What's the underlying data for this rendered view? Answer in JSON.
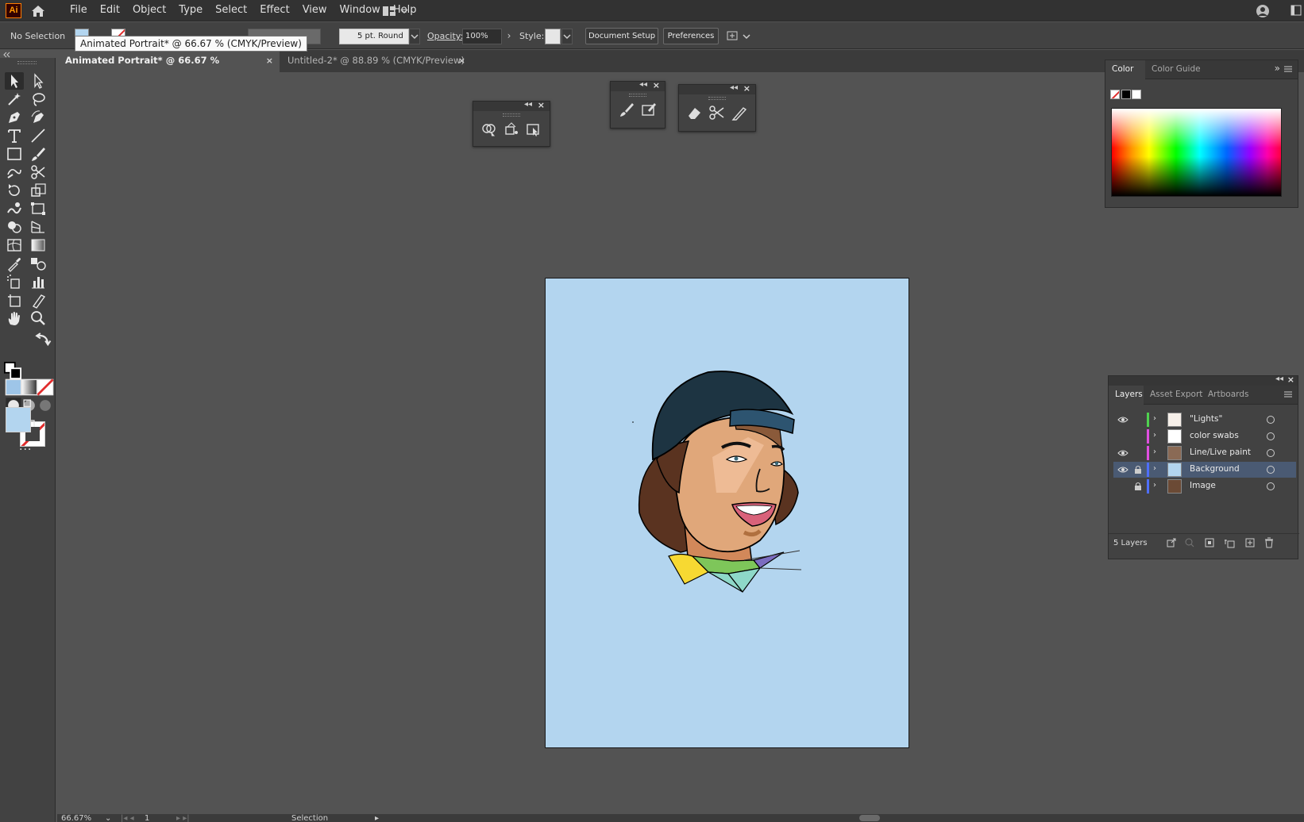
{
  "app": {
    "logo_text": "Ai",
    "menus": [
      "File",
      "Edit",
      "Object",
      "Type",
      "Select",
      "Effect",
      "View",
      "Window",
      "Help"
    ]
  },
  "control_bar": {
    "selection_status": "No Selection",
    "brush_definition": "5 pt. Round",
    "opacity_label": "Opacity:",
    "opacity_value": "100%",
    "style_label": "Style:",
    "document_setup_label": "Document Setup",
    "preferences_label": "Preferences",
    "tooltip": "Animated Portrait* @ 66.67 % (CMYK/Preview)"
  },
  "tabs": [
    {
      "label": "Animated Portrait* @ 66.67 % (CMYK/Preview)",
      "close": "×",
      "active": true
    },
    {
      "label": "Untitled-2* @ 88.89 % (CMYK/Preview)",
      "close": "×",
      "active": false
    }
  ],
  "toolbar": {
    "fill_color": "#b3d5ef",
    "more_tools_label": "..."
  },
  "color_panel": {
    "tabs": [
      "Color",
      "Color Guide"
    ]
  },
  "layers_panel": {
    "tabs": [
      "Layers",
      "Asset Export",
      "Artboards"
    ],
    "layers": [
      {
        "name": "\"Lights\"",
        "visible": true,
        "locked": false,
        "color": "#4fd24f"
      },
      {
        "name": "color swabs",
        "visible": false,
        "locked": false,
        "color": "#e04fe0"
      },
      {
        "name": "Line/Live paint",
        "visible": true,
        "locked": false,
        "color": "#e04fe0"
      },
      {
        "name": "Background",
        "visible": true,
        "locked": true,
        "color": "#4f6fff"
      },
      {
        "name": "Image",
        "visible": false,
        "locked": true,
        "color": "#4f6fff"
      }
    ],
    "count_label": "5 Layers"
  },
  "status_bar": {
    "zoom": "66.67%",
    "artboard_number": "1",
    "current_tool": "Selection"
  },
  "colors": {
    "artboard_bg": "#b3d5ef",
    "ui_dark": "#323232",
    "ui_panel": "#424242",
    "canvas": "#535353",
    "selected_layer": "#4a5a73"
  }
}
